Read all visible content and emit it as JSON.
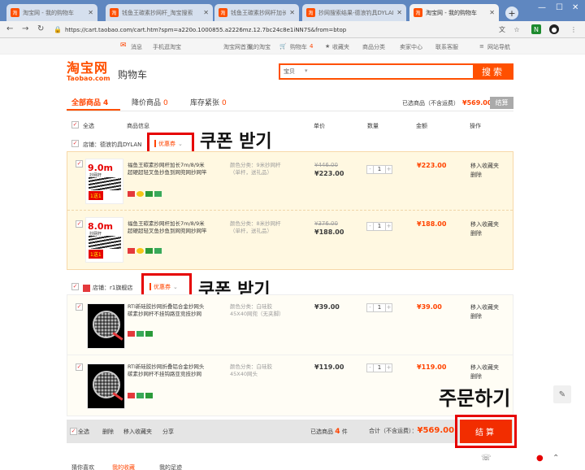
{
  "browser": {
    "tabs": [
      {
        "label": "淘宝网 - 我的购物车",
        "active": false
      },
      {
        "label": "钱鱼王碳素抄网杆_淘宝搜索",
        "active": false
      },
      {
        "label": "钱鱼王碳素抄网杆加长7m/8/9",
        "active": false
      },
      {
        "label": "抄网搜索结果-德浪钓具DYLAN",
        "active": false
      },
      {
        "label": "淘宝网 - 我的购物车",
        "active": true
      }
    ],
    "new_tab": "+",
    "url": "https://cart.taobao.com/cart.htm?spm=a220o.1000855.a2226mz.12.7bc24c8e1iNN7S&from=btop"
  },
  "topnav": {
    "welcome": "消息",
    "mobile": "手机逛淘宝",
    "home": "淘宝网首页",
    "mytaobao": "我的淘宝",
    "cart": "购物车",
    "cart_count": "4",
    "favorites": "收藏夹",
    "categories": "商品分类",
    "seller": "卖家中心",
    "service": "联系客服",
    "sitemap": "网站导航"
  },
  "header": {
    "logo_cn": "淘宝网",
    "logo_en": "Taobao.com",
    "title": "购物车",
    "search_scope": "宝贝",
    "search_button": "搜索"
  },
  "filters": {
    "all_label": "全部商品",
    "all_count": "4",
    "price_drop_label": "降价商品",
    "price_drop_count": "0",
    "low_stock_label": "库存紧张",
    "low_stock_count": "0",
    "selected_label": "已选商品（不含运费）",
    "selected_price": "¥569.00",
    "settle_small": "结算"
  },
  "columns": {
    "select_all": "全选",
    "info": "商品信息",
    "unit_price": "单价",
    "quantity": "数量",
    "amount": "金额",
    "ops": "操作"
  },
  "shops": [
    {
      "label": "店铺：",
      "name": "德浪钓具DYLAN",
      "coupon": "优惠券",
      "annotation": "쿠폰 받기",
      "items": [
        {
          "title": "福鱼王碳素抄网杆加长7m/8/9米超硬超轻叉鱼抄鱼到网兜网抄网竿",
          "thumb_text": "9.0m",
          "thumb_sub": "抄网杆",
          "thumb_badge": "1送1",
          "props": "颜色分类：9米抄网杆（单杆，送礼品）",
          "old_price": "¥446.00",
          "price": "¥223.00",
          "qty": "1",
          "subtotal": "¥223.00",
          "op1": "移入收藏夹",
          "op2": "删除"
        },
        {
          "title": "福鱼王碳素抄网杆加长7m/8/9米超硬超轻叉鱼抄鱼到网兜网抄网竿",
          "thumb_text": "8.0m",
          "thumb_sub": "抄网杆",
          "thumb_badge": "1送1",
          "props": "颜色分类：8米抄网杆（单杆，送礼品）",
          "old_price": "¥376.00",
          "price": "¥188.00",
          "qty": "1",
          "subtotal": "¥188.00",
          "op1": "移入收藏夹",
          "op2": "删除"
        }
      ]
    },
    {
      "label": "店铺：",
      "name": "r1旗舰店",
      "coupon": "优惠券",
      "annotation": "쿠폰 받기",
      "items": [
        {
          "title": "RTI新硅胶抄网折叠铝合金抄网头碳素抄网杆不挂钩路亚竞技抄网",
          "props": "颜色分类：白硅胶45X40网兜（无夹脚）",
          "price": "¥39.00",
          "qty": "1",
          "subtotal": "¥39.00",
          "op1": "移入收藏夹",
          "op2": "删除"
        },
        {
          "title": "RTI新硅胶抄网折叠铝合金抄网头碳素抄网杆不挂钩路亚竞技抄网",
          "props": "颜色分类：白硅胶45X40网头",
          "price": "¥119.00",
          "qty": "1",
          "subtotal": "¥119.00",
          "op1": "移入收藏夹",
          "op2": "删除"
        }
      ]
    }
  ],
  "bottom": {
    "select_all": "全选",
    "delete": "删除",
    "move_fav": "移入收藏夹",
    "share": "分享",
    "selected_label": "已选商品",
    "selected_count": "4",
    "selected_unit": "件",
    "total_label": "合计（不含运费）：",
    "total": "¥569.00",
    "settle": "结算",
    "annotation": "주문하기"
  },
  "below_tabs": [
    "猜你喜欢",
    "我的收藏",
    "我的足迹"
  ],
  "colors": {
    "brand": "#ff5000",
    "price": "#f40",
    "highlight": "#e60000"
  }
}
